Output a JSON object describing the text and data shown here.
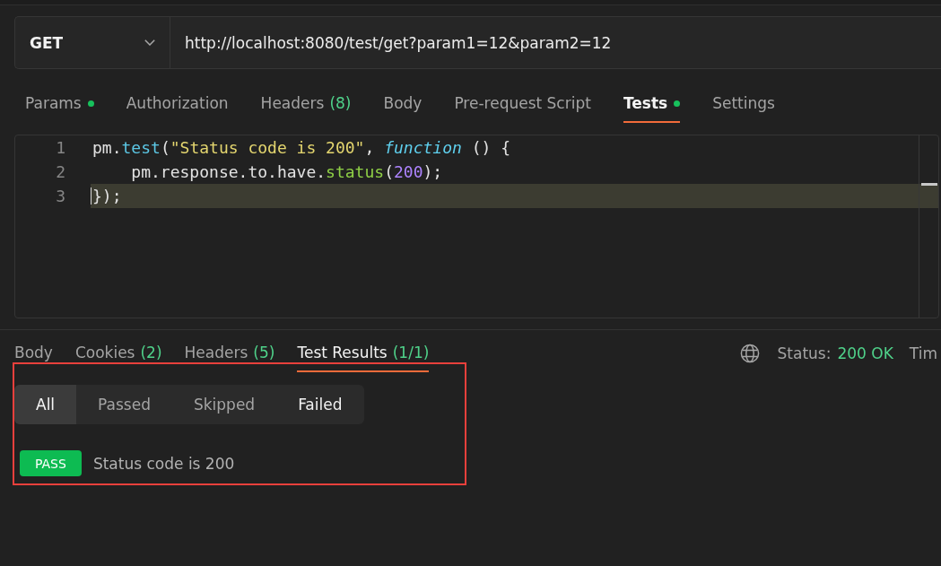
{
  "request": {
    "method": "GET",
    "url": "http://localhost:8080/test/get?param1=12&param2=12"
  },
  "request_tabs": [
    {
      "label": "Params",
      "dot": true,
      "selected": false
    },
    {
      "label": "Authorization",
      "dot": false,
      "selected": false
    },
    {
      "label": "Headers",
      "count": "(8)",
      "dot": false,
      "selected": false
    },
    {
      "label": "Body",
      "dot": false,
      "selected": false
    },
    {
      "label": "Pre-request Script",
      "dot": false,
      "selected": false
    },
    {
      "label": "Tests",
      "dot": true,
      "selected": true
    },
    {
      "label": "Settings",
      "dot": false,
      "selected": false
    }
  ],
  "editor": {
    "lines": [
      {
        "number": "1",
        "current": false,
        "tokens": [
          {
            "kind": "plain",
            "text": "pm."
          },
          {
            "kind": "method",
            "text": "test"
          },
          {
            "kind": "plain",
            "text": "("
          },
          {
            "kind": "string",
            "text": "\"Status code is 200\""
          },
          {
            "kind": "plain",
            "text": ", "
          },
          {
            "kind": "keyword",
            "text": "function"
          },
          {
            "kind": "plain",
            "text": " () {"
          }
        ]
      },
      {
        "number": "2",
        "current": false,
        "tokens": [
          {
            "kind": "plain",
            "text": "    pm.response.to.have."
          },
          {
            "kind": "call",
            "text": "status"
          },
          {
            "kind": "plain",
            "text": "("
          },
          {
            "kind": "number",
            "text": "200"
          },
          {
            "kind": "plain",
            "text": ");"
          }
        ]
      },
      {
        "number": "3",
        "current": true,
        "tokens": [
          {
            "kind": "plain",
            "text": "});"
          }
        ]
      }
    ]
  },
  "response_tabs": [
    {
      "label": "Body",
      "selected": false
    },
    {
      "label": "Cookies",
      "count": "(2)",
      "selected": false
    },
    {
      "label": "Headers",
      "count": "(5)",
      "selected": false
    },
    {
      "label": "Test Results",
      "count": "(1/1)",
      "selected": true
    }
  ],
  "response_status": {
    "label": "Status:",
    "value": "200 OK",
    "next_label": "Tim"
  },
  "test_filter": [
    {
      "label": "All",
      "selected": true,
      "hovered": false
    },
    {
      "label": "Passed",
      "selected": false,
      "hovered": false
    },
    {
      "label": "Skipped",
      "selected": false,
      "hovered": false
    },
    {
      "label": "Failed",
      "selected": false,
      "hovered": true
    }
  ],
  "results": [
    {
      "kind": "pass",
      "badge": "PASS",
      "name": "Status code is 200"
    }
  ]
}
